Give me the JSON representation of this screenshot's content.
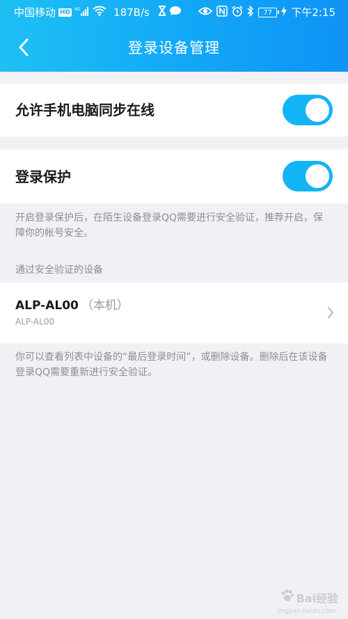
{
  "status_bar": {
    "carrier": "中国移动",
    "hd": "HD",
    "network": "4G",
    "speed": "187B/s",
    "battery": "77",
    "time": "下午2:15"
  },
  "nav": {
    "title": "登录设备管理"
  },
  "sync_online": {
    "label": "允许手机电脑同步在线",
    "enabled": true
  },
  "login_protect": {
    "label": "登录保护",
    "enabled": true,
    "note": "开启登录保护后，在陌生设备登录QQ需要进行安全验证，推荐开启，保障你的帐号安全。"
  },
  "verified_devices": {
    "section_title": "通过安全验证的设备",
    "items": [
      {
        "name": "ALP-AL00",
        "tag": "（本机）",
        "model": "ALP-AL00"
      }
    ],
    "note": "你可以查看列表中设备的“最后登录时间”，或删除设备。删除后在该设备登录QQ需要重新进行安全验证。"
  },
  "watermark": {
    "brand": "Bai经验",
    "url": "jingyan.baidu.com"
  },
  "colors": {
    "header_start": "#1ec0f4",
    "header_end": "#0f93f5",
    "toggle_on": "#13b4f5",
    "page_bg": "#f1f1f5"
  }
}
